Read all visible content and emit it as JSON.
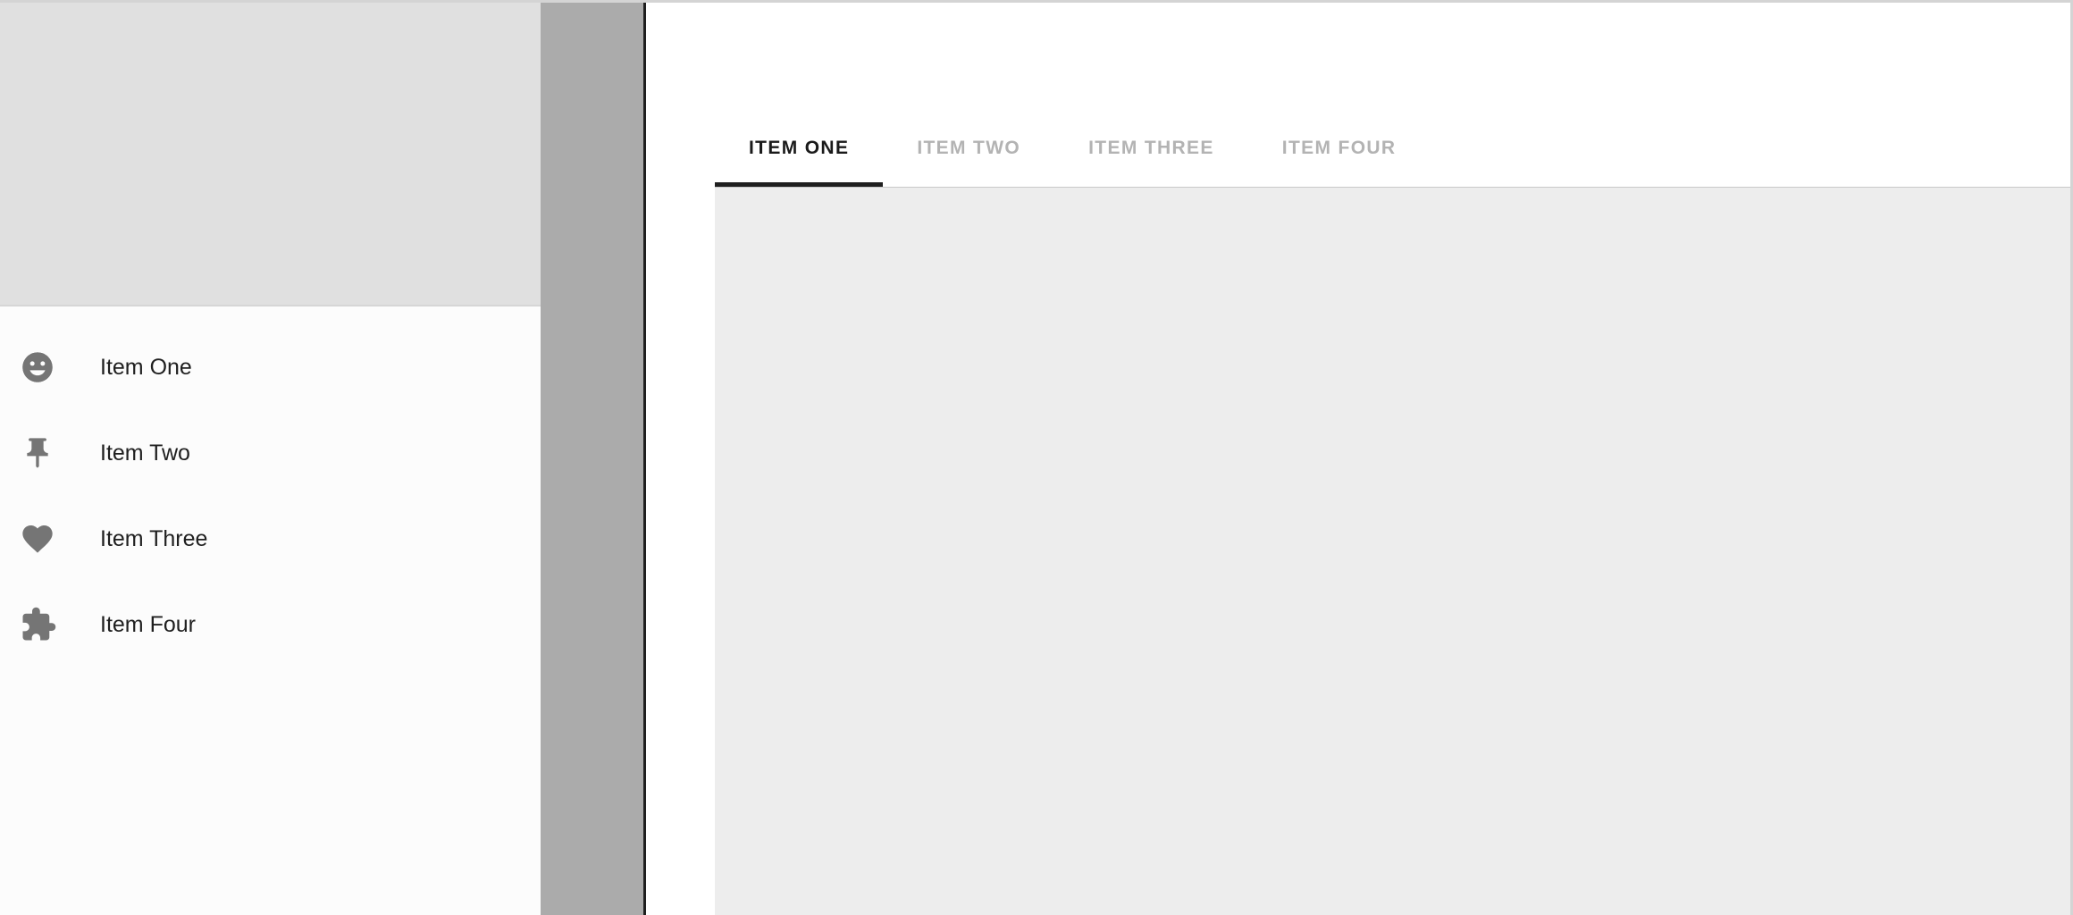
{
  "colors": {
    "scrim": "#ababab",
    "drawer_surface": "#fcfcfc",
    "drawer_header": "#e0e0e0",
    "icon": "#757575",
    "tab_active_text": "#1a1a1a",
    "tab_inactive_text": "#b3b3b3",
    "tab_indicator": "#1f1f1f",
    "content_background": "#ededed",
    "app_bar_background": "#ffffff",
    "window_border": "#d4d4d4"
  },
  "drawer": {
    "header": {
      "title": "",
      "subtitle": ""
    },
    "items": [
      {
        "label": "Item One",
        "icon": "mood-icon"
      },
      {
        "label": "Item Two",
        "icon": "pushpin-icon"
      },
      {
        "label": "Item Three",
        "icon": "heart-icon"
      },
      {
        "label": "Item Four",
        "icon": "puzzle-piece-icon"
      }
    ]
  },
  "app_bar": {
    "title": "",
    "tabs": [
      {
        "label": "ITEM ONE",
        "active": true
      },
      {
        "label": "ITEM TWO",
        "active": false
      },
      {
        "label": "ITEM THREE",
        "active": false
      },
      {
        "label": "ITEM FOUR",
        "active": false
      }
    ]
  },
  "tab_panel": {
    "content": ""
  }
}
